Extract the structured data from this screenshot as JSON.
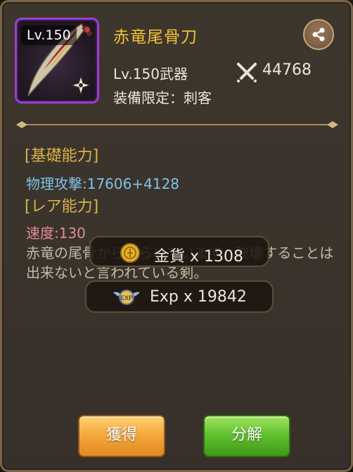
{
  "item": {
    "level_badge": "Lv.150",
    "name": "赤竜尾骨刀",
    "type_line": "Lv.150武器",
    "restriction": "装備限定：刺客",
    "power": "44768"
  },
  "sections": {
    "base_title": "[基礎能力]",
    "base_stat": "物理攻撃:17606+4128",
    "rare_title": "[レア能力]",
    "rare_stat": "速度:130"
  },
  "description": "赤竜の尾骨から作られています。破壊することは出来ないと言われている剣。",
  "rewards": {
    "gold": "金貨 x 1308",
    "exp": "Exp x 19842"
  },
  "buttons": {
    "obtain": "獲得",
    "dismantle": "分解"
  },
  "icons": {
    "share": "share-icon",
    "power": "crossed-swords-icon",
    "gold": "gold-coin-icon",
    "exp": "exp-wings-icon",
    "class": "assassin-shuriken-icon"
  },
  "colors": {
    "item_name": "#f2c436",
    "section_title": "#d9b24a",
    "base_stat": "#7fc2e8",
    "rare_stat": "#e58a96",
    "icon_frame": "#9b3fcf"
  }
}
